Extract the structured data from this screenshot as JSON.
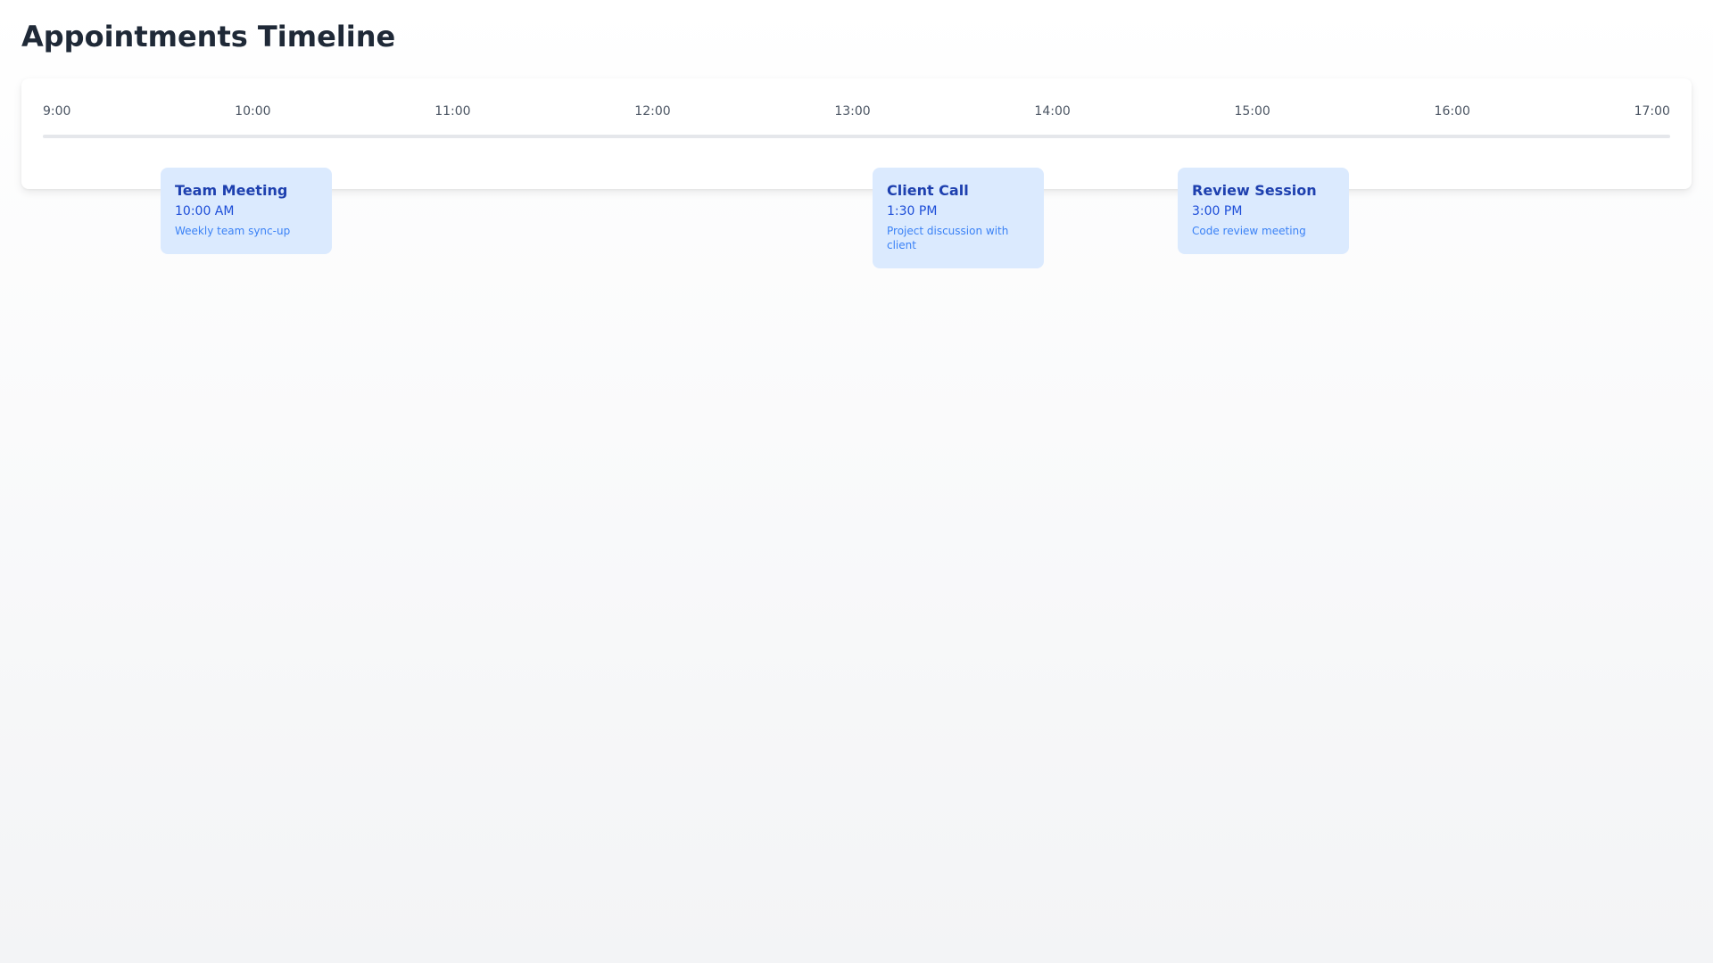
{
  "page": {
    "title": "Appointments Timeline"
  },
  "timeline": {
    "hours": [
      "9:00",
      "10:00",
      "11:00",
      "12:00",
      "13:00",
      "14:00",
      "15:00",
      "16:00",
      "17:00"
    ]
  },
  "appointments": [
    {
      "title": "Team Meeting",
      "time": "10:00 AM",
      "description": "Weekly team sync-up"
    },
    {
      "title": "Client Call",
      "time": "1:30 PM",
      "description": "Project discussion with client"
    },
    {
      "title": "Review Session",
      "time": "3:00 PM",
      "description": "Code review meeting"
    }
  ],
  "colors": {
    "title_text": "#1f2937",
    "appointment_bg": "#dbeafe",
    "appointment_title": "#1e40af",
    "appointment_time": "#1d4ed8",
    "appointment_desc": "#3b82f6",
    "track": "#e5e7eb"
  }
}
